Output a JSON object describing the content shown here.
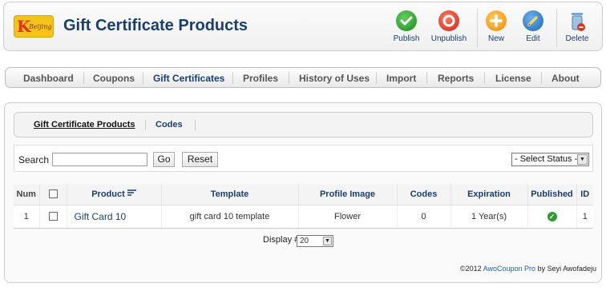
{
  "header": {
    "logo_text": "Beijing",
    "title": "Gift Certificate Products",
    "toolbar": {
      "publish": "Publish",
      "unpublish": "Unpublish",
      "new": "New",
      "edit": "Edit",
      "delete": "Delete"
    }
  },
  "nav": {
    "items": [
      "Dashboard",
      "Coupons",
      "Gift Certificates",
      "Profiles",
      "History of Uses",
      "Import",
      "Reports",
      "License",
      "About"
    ],
    "active": "Gift Certificates"
  },
  "subnav": {
    "items": [
      "Gift Certificate Products",
      "Codes"
    ]
  },
  "filter": {
    "search_label": "Search",
    "search_value": "",
    "go": "Go",
    "reset": "Reset",
    "status_selected": "- Select Status -"
  },
  "table": {
    "headers": {
      "num": "Num",
      "product": "Product",
      "template": "Template",
      "profile_image": "Profile Image",
      "codes": "Codes",
      "expiration": "Expiration",
      "published": "Published",
      "id": "ID"
    },
    "rows": [
      {
        "num": "1",
        "product": "Gift Card 10",
        "template": "gift card 10 template",
        "profile_image": "Flower",
        "codes": "0",
        "expiration": "1 Year(s)",
        "published": true,
        "id": "1"
      }
    ]
  },
  "pagination": {
    "display_label": "Display #",
    "display_value": "20"
  },
  "footer": {
    "prefix": "©2012",
    "link": "AwoCoupon Pro",
    "suffix": "by Seyi Awofadeju"
  },
  "colors": {
    "title": "#1b3d6e",
    "publish_green": "#2e9b2e",
    "unpublish_red": "#d9341f",
    "new_orange": "#f5a318",
    "edit_blue": "#2b78c5"
  }
}
